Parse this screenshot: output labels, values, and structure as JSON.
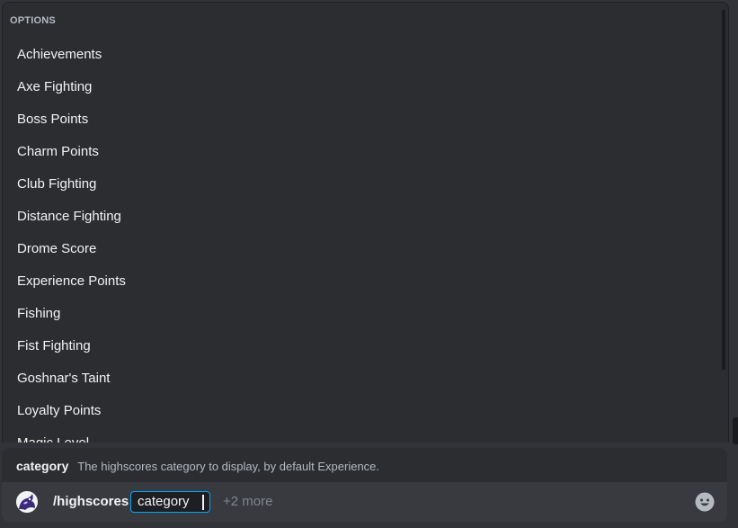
{
  "autocomplete": {
    "header": "OPTIONS",
    "options": [
      "Achievements",
      "Axe Fighting",
      "Boss Points",
      "Charm Points",
      "Club Fighting",
      "Distance Fighting",
      "Drome Score",
      "Experience Points",
      "Fishing",
      "Fist Fighting",
      "Goshnar's Taint",
      "Loyalty Points",
      "Magic Level"
    ]
  },
  "parameter_hint": {
    "name": "category",
    "description": "The highscores category to display, by default Experience."
  },
  "command_bar": {
    "command": "/highscores",
    "active_param": "category",
    "more_params": "+2 more"
  },
  "icons": {
    "app_avatar": "bot-avatar-icon",
    "emoji": "emoji-smile-icon"
  },
  "colors": {
    "background": "#313338",
    "popup_background": "#2b2d31",
    "input_background": "#383a40",
    "focus_accent": "#00a8fc"
  }
}
